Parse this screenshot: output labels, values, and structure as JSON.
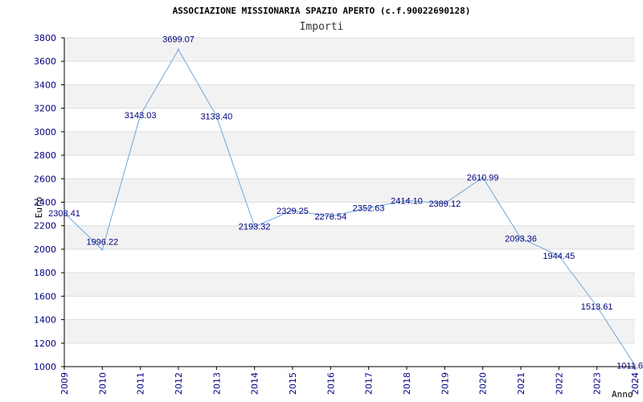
{
  "chart_data": {
    "type": "line",
    "title": "ASSOCIAZIONE MISSIONARIA SPAZIO APERTO (c.f.90022690128)",
    "subtitle": "Importi",
    "xlabel": "Anno",
    "ylabel": "Euro",
    "ylim": [
      1000,
      3800
    ],
    "yticks": [
      1000,
      1200,
      1400,
      1600,
      1800,
      2000,
      2200,
      2400,
      2600,
      2800,
      3000,
      3200,
      3400,
      3600,
      3800
    ],
    "grid": true,
    "x": [
      "2009",
      "2010",
      "2011",
      "2012",
      "2013",
      "2014",
      "2015",
      "2016",
      "2017",
      "2018",
      "2019",
      "2020",
      "2021",
      "2022",
      "2023",
      "2024"
    ],
    "series": [
      {
        "values": [
          2308.41,
          1996.22,
          3143.03,
          3699.07,
          3133.4,
          2193.32,
          2329.25,
          2278.54,
          2352.63,
          2414.1,
          2389.12,
          2610.99,
          2093.36,
          1944.45,
          1513.61,
          1011.6
        ],
        "labels": [
          "2308.41",
          "1996.22",
          "3143.03",
          "3699.07",
          "3133.40",
          "2193.32",
          "2329.25",
          "2278.54",
          "2352.63",
          "2414.10",
          "2389.12",
          "2610.99",
          "2093.36",
          "1944.45",
          "1513.61",
          "1011.6"
        ]
      }
    ],
    "colors": {
      "line": "#6fa8dc",
      "band": "#f2f2f2",
      "grid": "#dddddd",
      "tick_text": "#000080",
      "axis": "#000000"
    }
  }
}
